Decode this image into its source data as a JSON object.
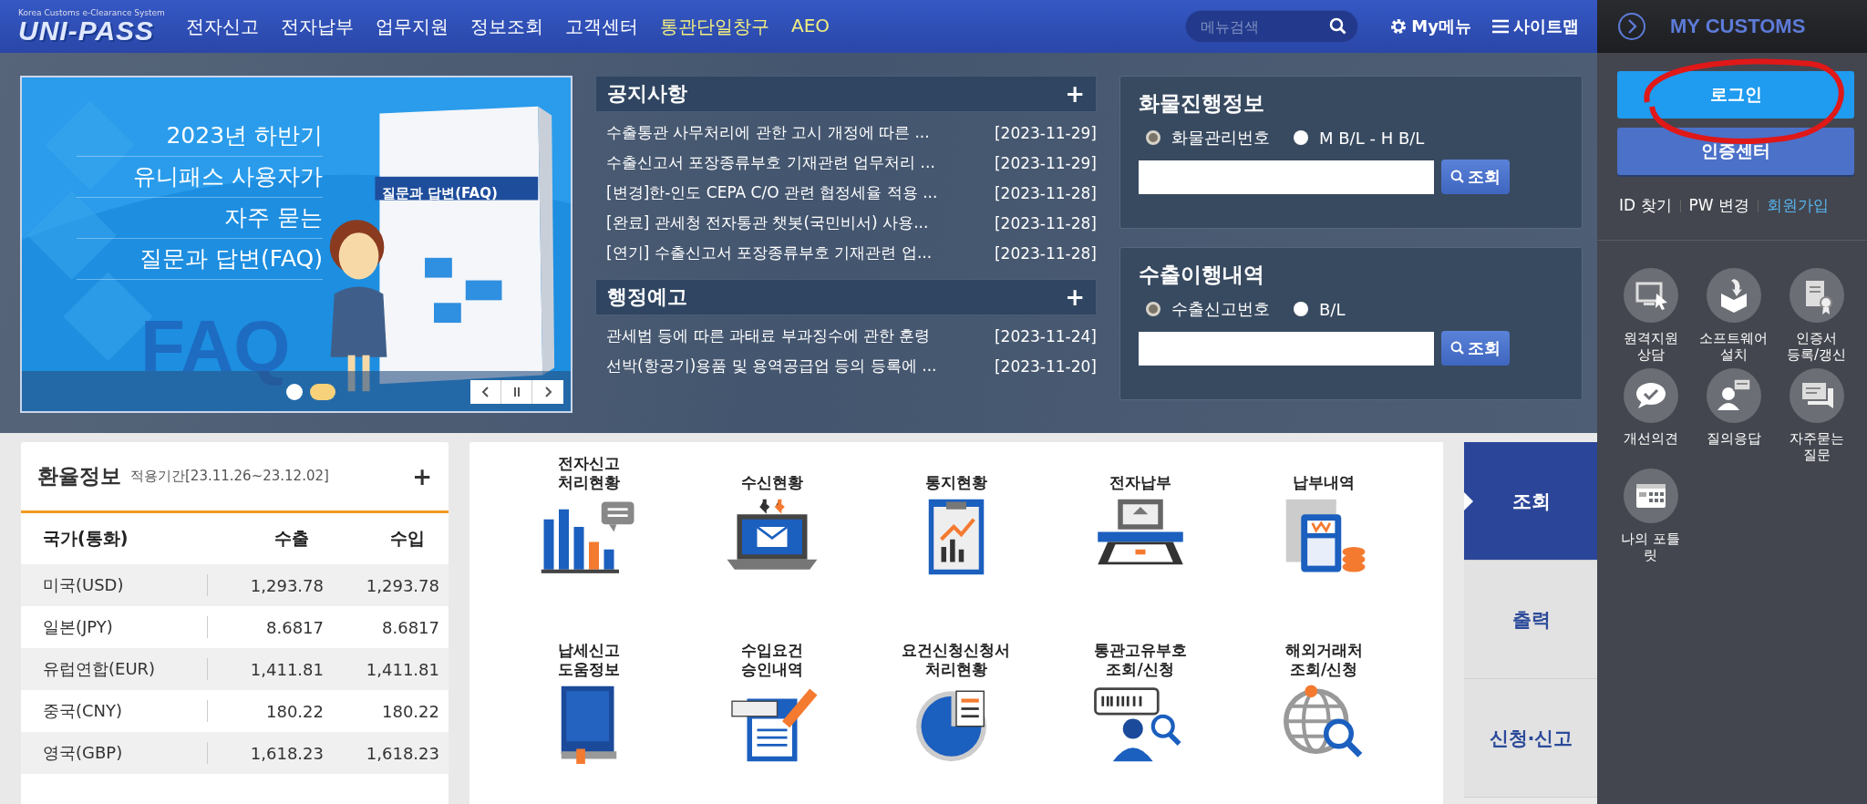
{
  "header": {
    "logo_caption": "Korea Customs e-Clearance System",
    "logo": "UNI-PASS",
    "nav": [
      {
        "label": "전자신고",
        "kind": "normal"
      },
      {
        "label": "전자납부",
        "kind": "normal"
      },
      {
        "label": "업무지원",
        "kind": "normal"
      },
      {
        "label": "정보조회",
        "kind": "normal"
      },
      {
        "label": "고객센터",
        "kind": "normal"
      },
      {
        "label": "통관단일창구",
        "kind": "highlight"
      },
      {
        "label": "AEO",
        "kind": "highlight"
      }
    ],
    "search": {
      "placeholder": "메뉴검색"
    },
    "my_menu": "My메뉴",
    "sitemap": "사이트맵"
  },
  "banner": {
    "headline": [
      "2023년 하반기",
      "유니패스 사용자가",
      "자주 묻는",
      "질문과 답변(FAQ)"
    ],
    "book_title": "질문과 답변(FAQ)",
    "backdrop_text": "FAQ",
    "dots": [
      {
        "selected": false
      },
      {
        "selected": true
      }
    ]
  },
  "notices": {
    "title": "공지사항",
    "more": "+",
    "items": [
      {
        "title": "수출통관 사무처리에 관한 고시 개정에 따른 ...",
        "date": "[2023-11-29]"
      },
      {
        "title": "수출신고서 포장종류부호 기재관련 업무처리 ...",
        "date": "[2023-11-29]"
      },
      {
        "title": "[변경]한-인도 CEPA C/O 관련 협정세율 적용 ...",
        "date": "[2023-11-28]"
      },
      {
        "title": "[완료] 관세청 전자통관 챗봇(국민비서) 사용...",
        "date": "[2023-11-28]"
      },
      {
        "title": "[연기] 수출신고서 포장종류부호 기재관련 업...",
        "date": "[2023-11-28]"
      }
    ]
  },
  "admin_notices": {
    "title": "행정예고",
    "more": "+",
    "items": [
      {
        "title": "관세법 등에 따른 과태료 부과징수에 관한 훈령",
        "date": "[2023-11-24]"
      },
      {
        "title": "선박(항공기)용품 및 용역공급업 등의 등록에 ...",
        "date": "[2023-11-20]"
      }
    ]
  },
  "lookups": [
    {
      "title": "화물진행정보",
      "options": [
        {
          "label": "화물관리번호",
          "selected": true
        },
        {
          "label": "M B/L - H B/L",
          "selected": false
        }
      ],
      "button": "조회"
    },
    {
      "title": "수출이행내역",
      "options": [
        {
          "label": "수출신고번호",
          "selected": true
        },
        {
          "label": "B/L",
          "selected": false
        }
      ],
      "button": "조회"
    }
  ],
  "exchange": {
    "title": "환율정보",
    "period": "적용기간[23.11.26~23.12.02]",
    "more": "+",
    "columns": [
      "국가(통화)",
      "수출",
      "수입"
    ],
    "rows": [
      [
        "미국(USD)",
        "1,293.78",
        "1,293.78"
      ],
      [
        "일본(JPY)",
        "8.6817",
        "8.6817"
      ],
      [
        "유럽연합(EUR)",
        "1,411.81",
        "1,411.81"
      ],
      [
        "중국(CNY)",
        "180.22",
        "180.22"
      ],
      [
        "영국(GBP)",
        "1,618.23",
        "1,618.23"
      ]
    ]
  },
  "services": [
    {
      "lines": [
        "전자신고",
        "처리현황"
      ]
    },
    {
      "lines": [
        "수신현황"
      ]
    },
    {
      "lines": [
        "통지현황"
      ]
    },
    {
      "lines": [
        "전자납부"
      ]
    },
    {
      "lines": [
        "납부내역"
      ]
    },
    {
      "lines": [
        "납세신고",
        "도움정보"
      ]
    },
    {
      "lines": [
        "수입요건",
        "승인내역"
      ]
    },
    {
      "lines": [
        "요건신청신청서",
        "처리현황"
      ]
    },
    {
      "lines": [
        "통관고유부호",
        "조회/신청"
      ]
    },
    {
      "lines": [
        "해외거래처",
        "조회/신청"
      ]
    }
  ],
  "side_tabs": [
    {
      "label": "조회",
      "selected": true
    },
    {
      "label": "출력",
      "selected": false
    },
    {
      "label": "신청·신고",
      "selected": false
    }
  ],
  "my_customs": {
    "title": "MY CUSTOMS",
    "login": "로그인",
    "cert_center": "인증센터",
    "links": [
      {
        "label": "ID 찾기",
        "kind": "plain"
      },
      {
        "label": "PW 변경",
        "kind": "plain"
      },
      {
        "label": "회원가입",
        "kind": "accent"
      }
    ],
    "shortcuts": [
      {
        "lines": [
          "원격지원",
          "상담"
        ]
      },
      {
        "lines": [
          "소프트웨어",
          "설치"
        ]
      },
      {
        "lines": [
          "인증서",
          "등록/갱신"
        ]
      },
      {
        "lines": [
          "개선의견"
        ]
      },
      {
        "lines": [
          "질의응답"
        ]
      },
      {
        "lines": [
          "자주묻는",
          "질문"
        ]
      },
      {
        "lines": [
          "나의 포틀",
          "릿"
        ]
      }
    ]
  }
}
